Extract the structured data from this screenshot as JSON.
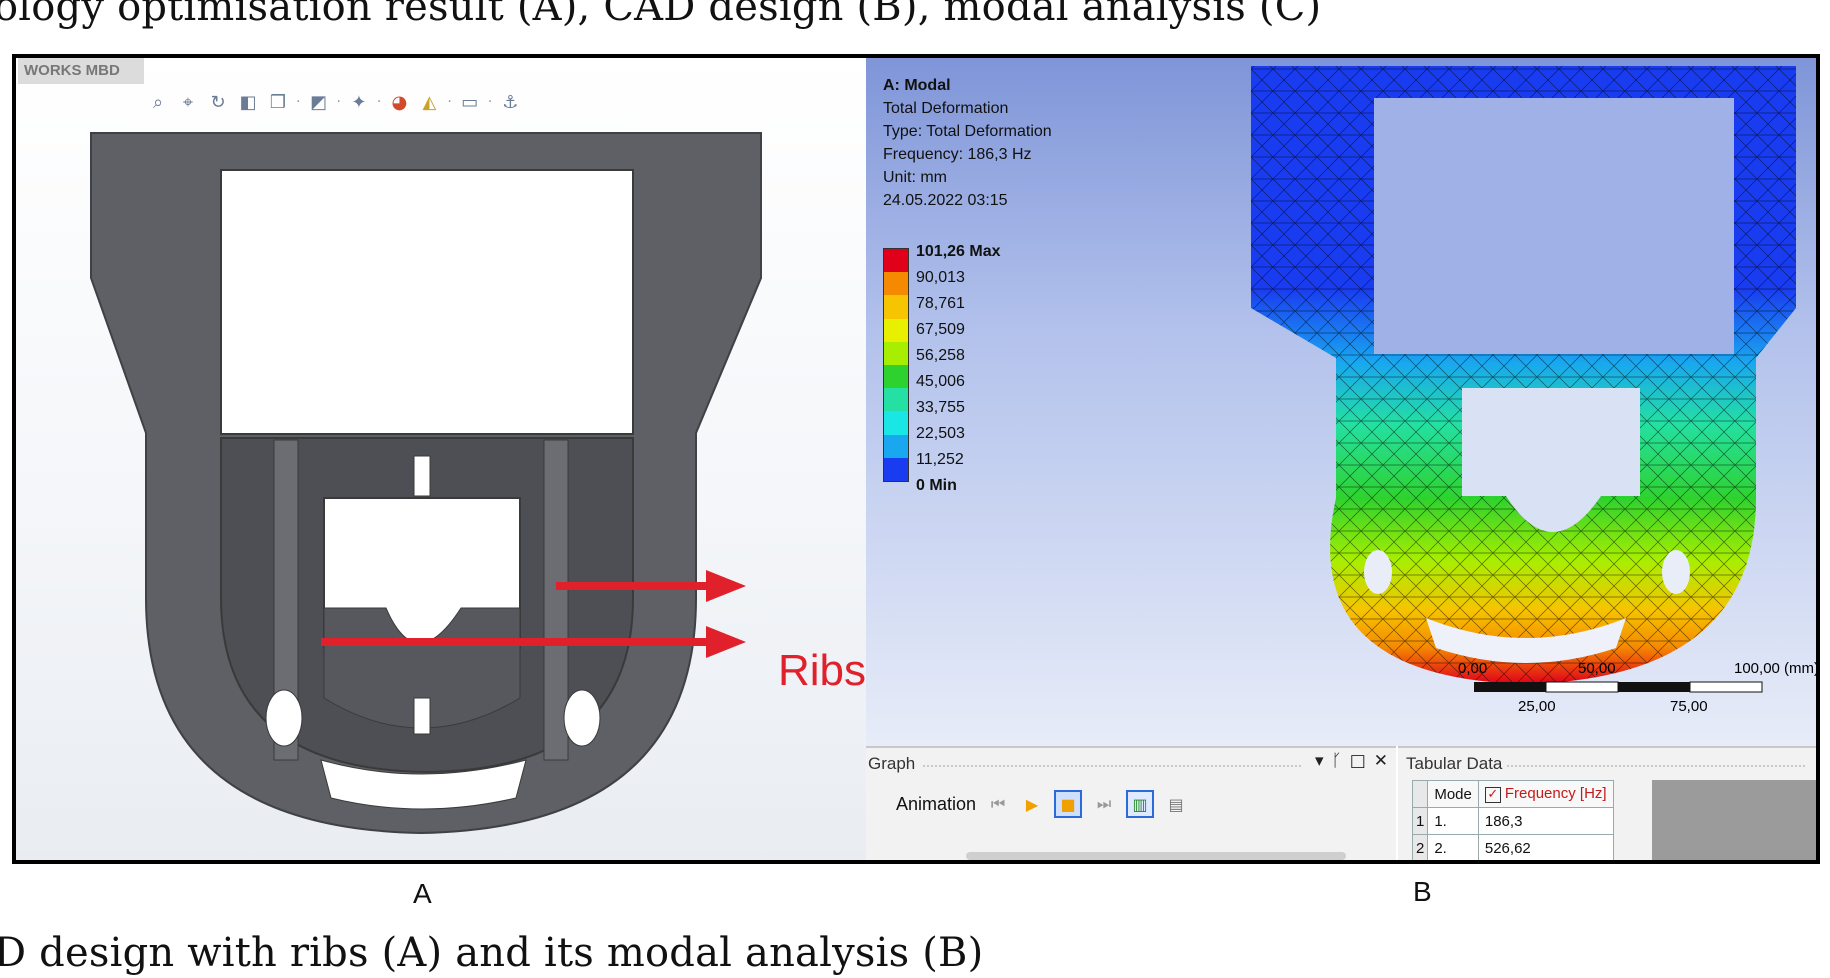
{
  "captions": {
    "top": "ology optimisation result (A), CAD design (B), modal analysis (C)",
    "bottom": "D design with ribs (A) and its modal analysis (B)"
  },
  "panel_a": {
    "label": "A",
    "software_tag": "WORKS MBD",
    "annotation": "Ribs",
    "annotation_color": "#e0202a",
    "part_color": "#55575c",
    "toolbar_icons": [
      "zoom-icon",
      "zoom-area-icon",
      "rotate-icon",
      "section-view-icon",
      "view-orientation-icon",
      "display-style-icon",
      "hide-show-icon",
      "appearance-icon",
      "scene-icon",
      "monitor-icon",
      "triad-icon"
    ]
  },
  "panel_b": {
    "label": "B",
    "result_info": {
      "title": "A: Modal",
      "lines": [
        "Total Deformation",
        "Type: Total Deformation",
        "Frequency: 186,3 Hz",
        "Unit: mm",
        "24.05.2022 03:15"
      ]
    },
    "legend": {
      "max_label": "101,26 Max",
      "values": [
        "90,013",
        "78,761",
        "67,509",
        "56,258",
        "45,006",
        "33,755",
        "22,503",
        "11,252"
      ],
      "min_label": "0 Min",
      "colors": [
        "#e0001a",
        "#f58a00",
        "#f6c400",
        "#e8f000",
        "#a8ee00",
        "#2ed22e",
        "#24e0a2",
        "#1ae6e6",
        "#19a7f0",
        "#1a3cf0"
      ]
    },
    "scale_bar": {
      "top_labels": [
        "0,00",
        "50,00",
        "100,00 (mm)"
      ],
      "bottom_labels": [
        "25,00",
        "75,00"
      ]
    },
    "graph_pane": {
      "title": "Graph",
      "controls": [
        "▾",
        "ᚴ",
        "□",
        "✕"
      ],
      "animation_label": "Animation"
    },
    "tabular_data": {
      "title": "Tabular Data",
      "columns": [
        "Mode",
        "Frequency [Hz]"
      ],
      "rows": [
        {
          "num": "1",
          "mode": "1.",
          "freq": "186,3"
        },
        {
          "num": "2",
          "mode": "2.",
          "freq": "526,62"
        }
      ]
    }
  }
}
